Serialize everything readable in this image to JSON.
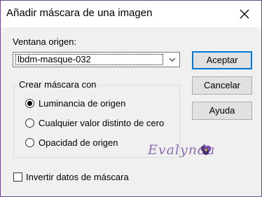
{
  "window": {
    "title": "Añadir máscara de una imagen"
  },
  "source": {
    "label": "Ventana origen:",
    "selected": "lbdm-masque-032"
  },
  "buttons": {
    "accept": "Aceptar",
    "cancel": "Cancelar",
    "help": "Ayuda"
  },
  "mask_group": {
    "title": "Crear máscara con",
    "options": [
      {
        "label": "Luminancia de origen",
        "checked": true
      },
      {
        "label": "Cualquier valor distinto de cero",
        "checked": false
      },
      {
        "label": "Opacidad de origen",
        "checked": false
      }
    ]
  },
  "invert": {
    "label": "Invertir datos de máscara",
    "checked": false
  },
  "watermark": {
    "text": "Evalynda"
  },
  "colors": {
    "accent": "#0078d7",
    "frame": "#6b4a86",
    "watermark": "#8d6fb4"
  }
}
